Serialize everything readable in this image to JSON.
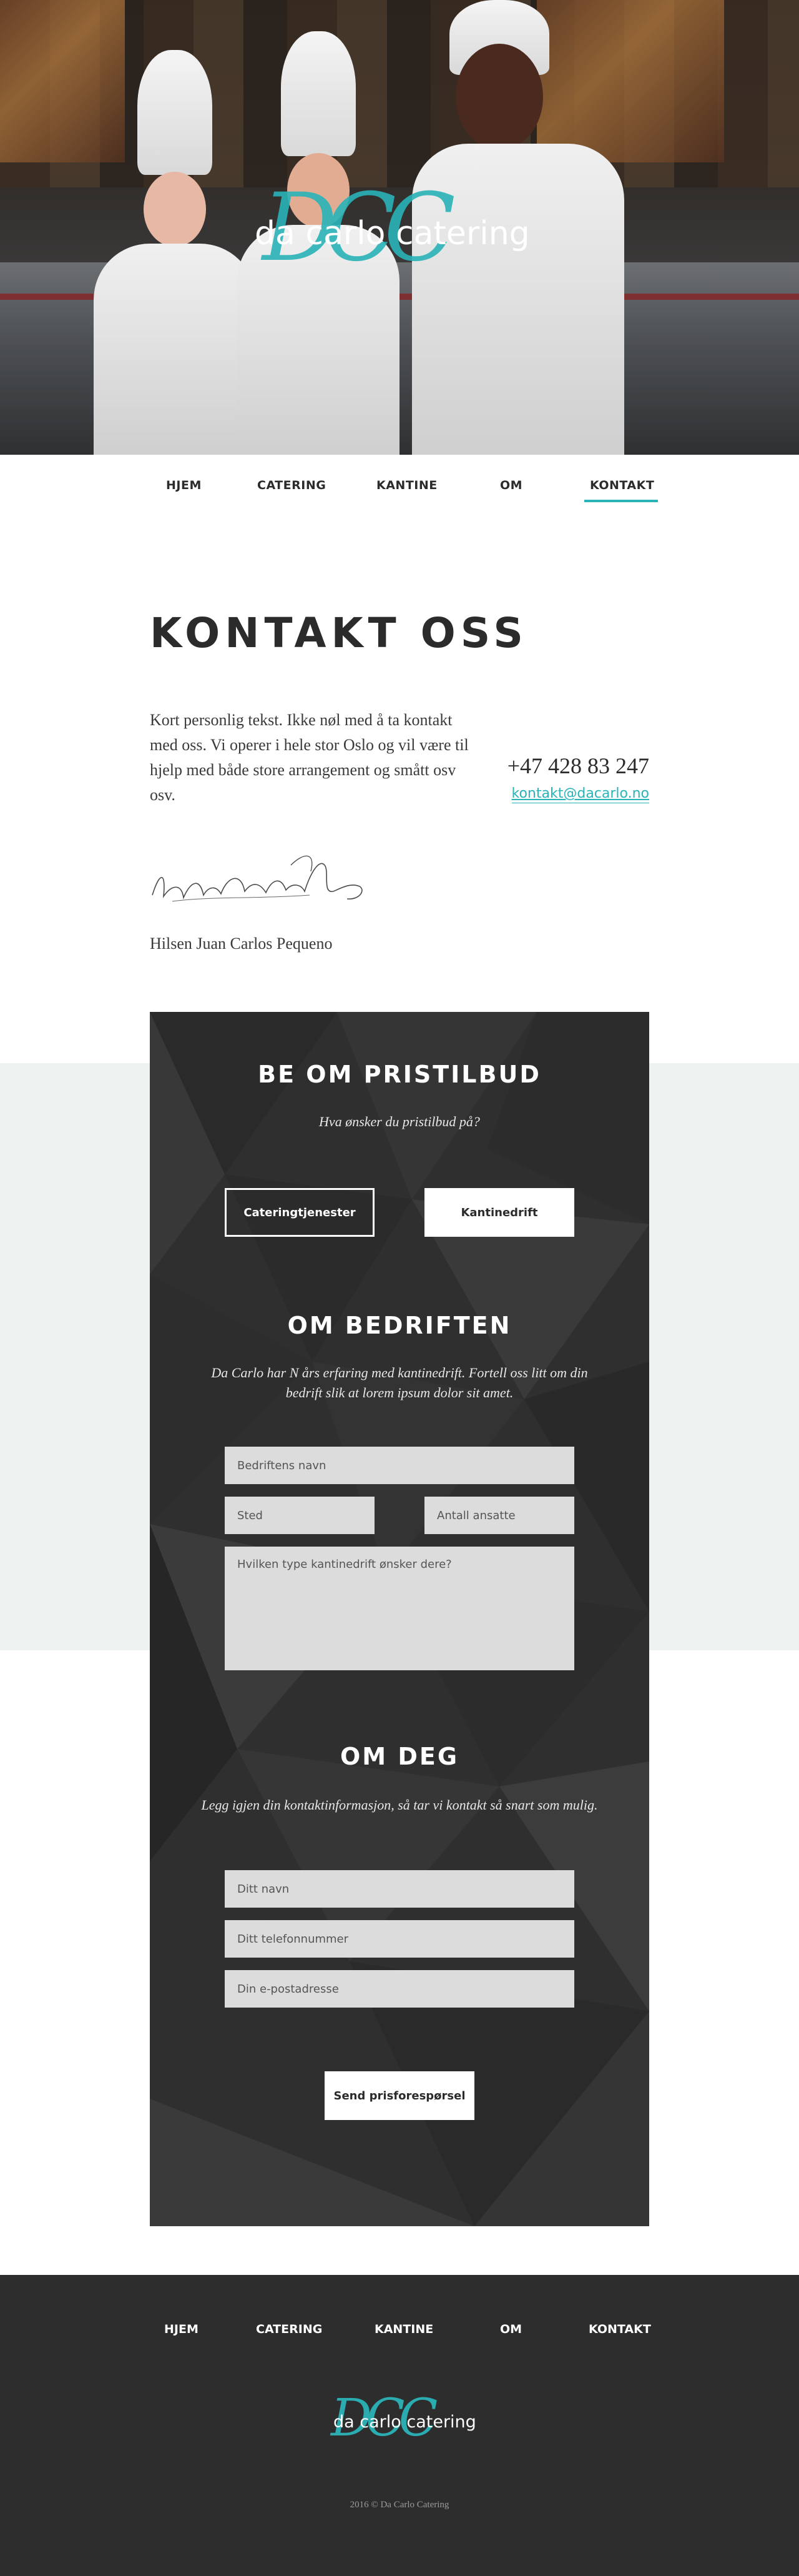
{
  "brand": {
    "script_initials": "DCC",
    "name": "da carlo catering"
  },
  "nav": {
    "items": [
      "HJEM",
      "CATERING",
      "KANTINE",
      "OM",
      "KONTAKT"
    ],
    "active": "KONTAKT"
  },
  "contact": {
    "title": "KONTAKT OSS",
    "intro": "Kort personlig tekst. Ikke nøl med å ta kontakt med oss. Vi operer i hele stor Oslo og vil være til hjelp med både store arrangement og smått osv osv.",
    "phone": "+47 428 83 247",
    "email": "kontakt@dacarlo.no",
    "greeting": "Hilsen Juan Carlos Pequeno"
  },
  "quote": {
    "title": "BE OM PRISTILBUD",
    "question": "Hva ønsker du pristilbud på?",
    "options": [
      "Cateringtjenester",
      "Kantinedrift"
    ],
    "selected": "Cateringtjenester"
  },
  "company": {
    "title": "OM BEDRIFTEN",
    "description": "Da Carlo har N års erfaring med kantinedrift. Fortell oss litt om din bedrift slik at lorem ipsum dolor sit amet.",
    "fields": {
      "company_name": "Bedriftens navn",
      "location": "Sted",
      "employees": "Antall ansatte",
      "canteen_type": "Hvilken type kantinedrift ønsker dere?"
    }
  },
  "about_you": {
    "title": "OM DEG",
    "description": "Legg igjen din kontaktinformasjon, så tar vi kontakt så snart som mulig.",
    "fields": {
      "name": "Ditt navn",
      "phone": "Ditt telefonnummer",
      "email": "Din e-postadresse"
    }
  },
  "submit_label": "Send prisforespørsel",
  "footer": {
    "nav": [
      "HJEM",
      "CATERING",
      "KANTINE",
      "OM",
      "KONTAKT"
    ],
    "copyright": "2016 © Da Carlo Catering"
  },
  "colors": {
    "accent": "#2ab3b8",
    "panel": "#2f2f2f",
    "footer": "#2e2d2e",
    "mint": "#edf2f1"
  }
}
